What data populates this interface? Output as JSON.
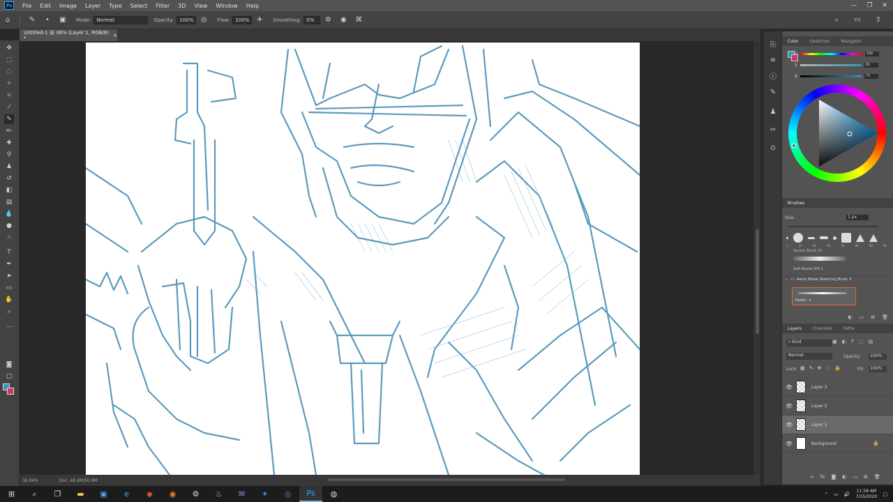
{
  "app": {
    "logo": "Ps"
  },
  "menu": [
    "File",
    "Edit",
    "Image",
    "Layer",
    "Type",
    "Select",
    "Filter",
    "3D",
    "View",
    "Window",
    "Help"
  ],
  "window_controls": [
    "—",
    "❐",
    "✕"
  ],
  "options_bar": {
    "mode_label": "Mode:",
    "mode_value": "Normal",
    "opacity_label": "Opacity:",
    "opacity_value": "100%",
    "flow_label": "Flow:",
    "flow_value": "100%",
    "smoothing_label": "Smoothing:",
    "smoothing_value": "0%"
  },
  "document_tab": {
    "title": "Untitled-1 @ 36% (Layer 1, RGB/8) *",
    "close": "×"
  },
  "status": {
    "zoom": "36.04%",
    "doc": "Doc: 48.2M/50.9M"
  },
  "color_panel": {
    "tabs": [
      "Color",
      "Swatches",
      "Navigator"
    ],
    "sliders": [
      {
        "label": "H",
        "value": "199"
      },
      {
        "label": "S",
        "value": "61"
      },
      {
        "label": "B",
        "value": "71"
      }
    ],
    "foreground": "#3f8fb5",
    "background": "#d6336c"
  },
  "brushes_panel": {
    "title": "Brushes",
    "size_label": "Size:",
    "size_value": "1 px",
    "sizes": [
      "1",
      "25",
      "45",
      "25",
      "16",
      "40",
      "40",
      "90"
    ],
    "preset1": "Square Brush 32",
    "preset2": "Soft Round 500 1",
    "group": "Aaron Blaise Sketching Brush 3",
    "selected": "Pastel - s"
  },
  "layers_panel": {
    "tabs": [
      "Layers",
      "Channels",
      "Paths"
    ],
    "filter_label": "Kind",
    "blend_mode": "Normal",
    "opacity_label": "Opacity:",
    "opacity_value": "100%",
    "lock_label": "Lock:",
    "fill_label": "Fill:",
    "fill_value": "100%",
    "layers": [
      {
        "name": "Layer 3",
        "selected": false,
        "locked": false
      },
      {
        "name": "Layer 2",
        "selected": false,
        "locked": false
      },
      {
        "name": "Layer 1",
        "selected": true,
        "locked": false
      },
      {
        "name": "Background",
        "selected": false,
        "locked": true
      }
    ]
  },
  "taskbar": {
    "apps": [
      "start-icon",
      "search-icon",
      "task-view-icon",
      "file-explorer-icon",
      "store-icon",
      "edge-icon",
      "app-red-icon",
      "app-orange-icon",
      "settings-icon",
      "steam-icon",
      "messenger-icon",
      "app-blue-icon",
      "signal-icon",
      "photoshop-icon",
      "obs-icon"
    ],
    "time": "11:58 AM",
    "date": "7/15/2020"
  },
  "colors": {
    "sketch_stroke": "#4a8fb5"
  }
}
